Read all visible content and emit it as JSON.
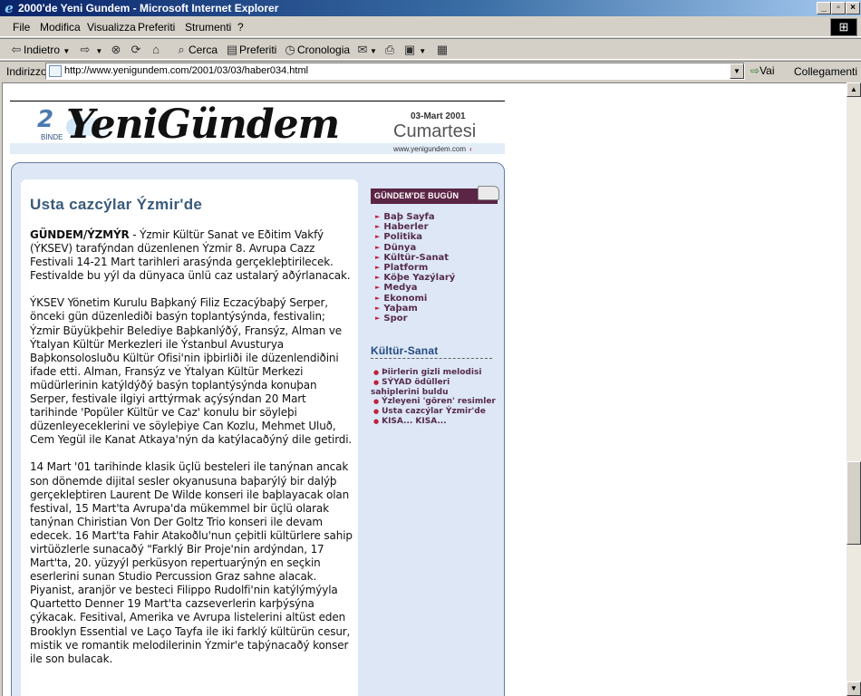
{
  "window": {
    "title": "2000'de Yeni Gundem - Microsoft Internet Explorer"
  },
  "menu": [
    "File",
    "Modifica",
    "Visualizza",
    "Preferiti",
    "Strumenti",
    "?"
  ],
  "toolbar": {
    "back": "Indietro",
    "search": "Cerca",
    "favorites": "Preferiti",
    "history": "Cronologia"
  },
  "address": {
    "label": "Indirizzo",
    "url": "http://www.yenigundem.com/2001/03/03/haber034.html",
    "go": "Vai",
    "links": "Collegamenti"
  },
  "header": {
    "logo_number": "2",
    "logo_small": "BİNDE",
    "logo_text": "YeniGündem",
    "date": "03-Mart 2001",
    "day": "Cumartesi",
    "site": "www.yenigundem.com"
  },
  "article": {
    "title": "Usta cazcýlar Ýzmir'de",
    "lead_bold": "GÜNDEM/ÝZMÝR",
    "lead_rest": " - Ýzmir Kültür Sanat ve Eðitim Vakfý (ÝKSEV) tarafýndan düzenlenen Ýzmir 8. Avrupa Cazz Festivali 14-21 Mart tarihleri arasýnda gerçekleþtirilecek. Festivalde bu yýl da dünyaca ünlü caz ustalarý aðýrlanacak.",
    "paragraphs": [
      "ÝKSEV Yönetim Kurulu Baþkaný Filiz Eczacýbaþý Serper, önceki gün düzenlediði basýn toplantýsýnda, festivalin; Ýzmir Büyükþehir Belediye Baþkanlýðý, Fransýz, Alman ve Ýtalyan Kültür Merkezleri ile Ýstanbul Avusturya Baþkonsolosluðu Kültür Ofisi'nin iþbirliði ile düzenlendiðini ifade etti. Alman, Fransýz ve Ýtalyan Kültür Merkezi müdürlerinin katýldýðý basýn toplantýsýnda konuþan Serper, festivale ilgiyi arttýrmak açýsýndan 20 Mart tarihinde 'Popüler Kültür ve Caz' konulu bir söyleþi düzenleyeceklerini ve söyleþiye Can Kozlu, Mehmet Uluð, Cem Yegül ile Kanat Atkaya'nýn da katýlacaðýný dile getirdi.",
      "14 Mart '01 tarihinde klasik üçlü besteleri ile tanýnan ancak son dönemde dijital sesler okyanusuna baþarýlý bir dalýþ gerçekleþtiren Laurent De Wilde konseri ile baþlayacak olan festival, 15 Mart'ta Avrupa'da mükemmel bir üçlü olarak tanýnan Chiristian Von Der Goltz Trio konseri ile devam edecek. 16 Mart'ta Fahir Atakoðlu'nun çeþitli kültürlere sahip virtüözlerle sunacaðý \"Farklý Bir Proje'nin ardýndan, 17 Mart'ta, 20. yüzyýl perküsyon repertuarýnýn en seçkin eserlerini sunan Studio Percussion Graz sahne alacak. Piyanist, aranjör ve besteci Filippo Rudolfi'nin katýlýmýyla Quartetto Denner 19 Mart'ta cazseverlerin karþýsýna çýkacak. Fesitival, Amerika ve Avrupa listelerini altüst eden Brooklyn Essential ve Laço Tayfa ile iki farklý kültürün cesur, mistik ve romantik melodilerinin Ýzmir'e taþýnacaðý konser ile son bulacak."
    ]
  },
  "sidebar": {
    "header": "GÜNDEM'DE BUGÜN",
    "links": [
      "Baþ Sayfa",
      "Haberler",
      "Politika",
      "Dünya",
      "Kültür-Sanat",
      "Platform",
      "Köþe Yazýlarý",
      "Medya",
      "Ekonomi",
      "Yaþam",
      "Spor"
    ],
    "section_title": "Kültür-Sanat",
    "section_items": [
      "Þiirlerin gizli melodisi",
      "SÝYAD ödülleri sahiplerini buldu",
      "Ýzleyeni 'gören' resimler",
      "Usta cazcýlar Ýzmir'de",
      "KISA... KISA..."
    ]
  },
  "colors": {
    "title_bar": "#0a246a",
    "chrome": "#d4d0c8",
    "content_bg": "#dde7f5",
    "article_title": "#395a7a",
    "sidebar_header": "#5b2545",
    "link_color": "#552b4c",
    "bullet": "#c0203a"
  },
  "icons": [
    "ie-icon",
    "back-icon",
    "forward-icon",
    "stop-icon",
    "refresh-icon",
    "home-icon",
    "search-icon",
    "favorites-icon",
    "history-icon",
    "mail-icon",
    "print-icon",
    "edit-icon",
    "discuss-icon",
    "page-icon",
    "go-icon",
    "windows-logo-icon",
    "folder-icon"
  ]
}
